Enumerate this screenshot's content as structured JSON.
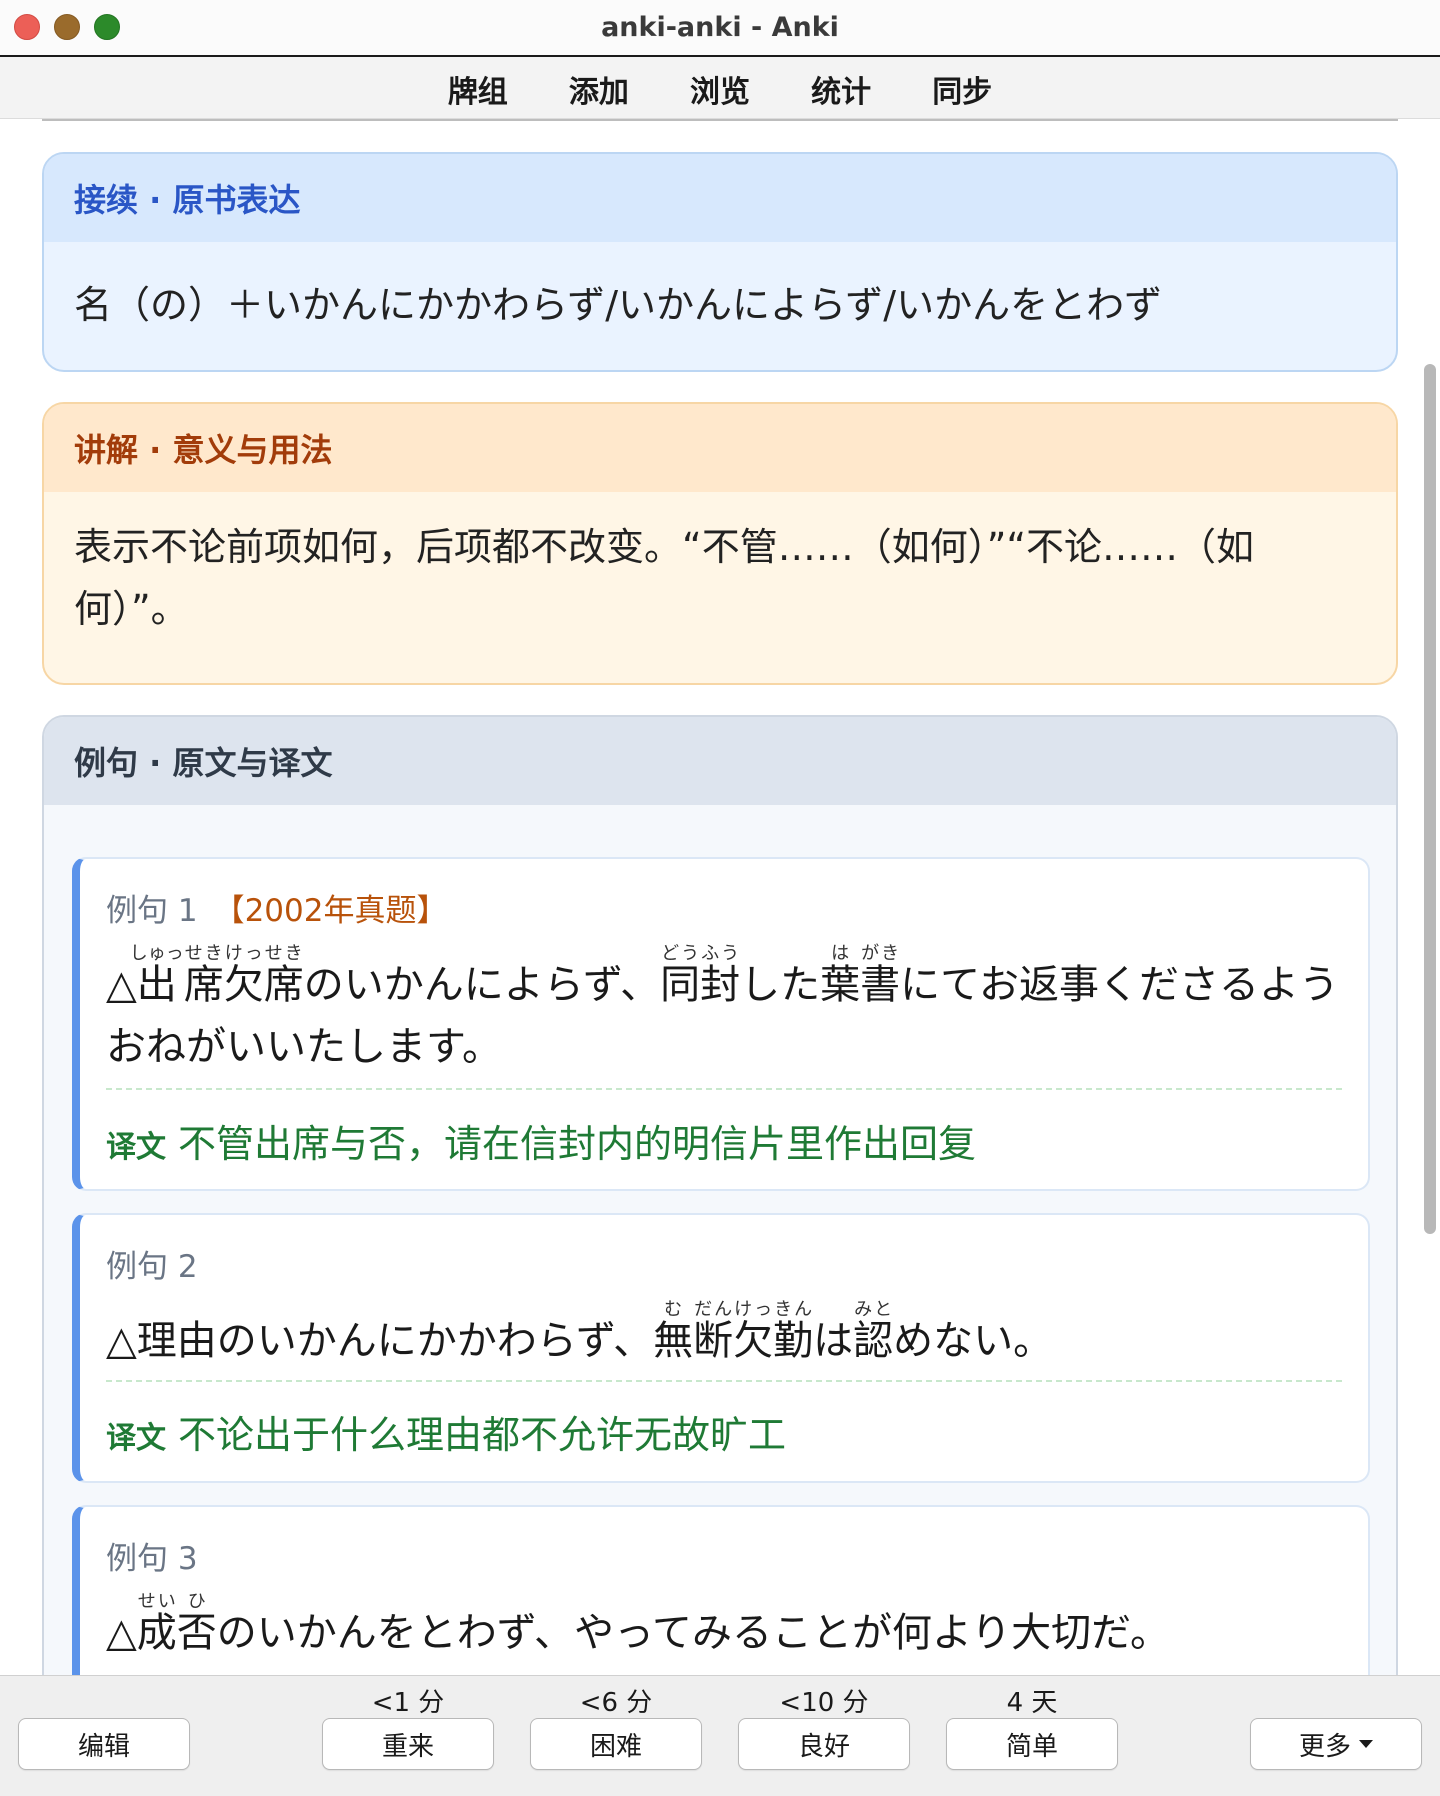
{
  "window": {
    "title": "anki-anki - Anki"
  },
  "menu": [
    "牌组",
    "添加",
    "浏览",
    "统计",
    "同步"
  ],
  "connection": {
    "header": "接续 · 原书表达",
    "text": "名（の）＋いかんにかかわらず/いかんによらず/いかんをとわず"
  },
  "explanation": {
    "header": "讲解 · 意义与用法",
    "text": "表示不论前项如何，后项都不改变。“不管……（如何）”“不论……（如何）”。"
  },
  "examples_section": {
    "header": "例句 · 原文与译文",
    "translation_label": "译文",
    "examples": [
      {
        "label": "例句 1",
        "tag": "【2002年真题】",
        "sentence": [
          {
            "t": "△"
          },
          {
            "t": "出",
            "r": "しゅっ"
          },
          {
            "t": "席",
            "r": "せき"
          },
          {
            "t": "欠",
            "r": "けっ"
          },
          {
            "t": "席",
            "r": "せき"
          },
          {
            "t": "のいかんによらず、"
          },
          {
            "t": "同",
            "r": "どう"
          },
          {
            "t": "封",
            "r": "ふう"
          },
          {
            "t": "した"
          },
          {
            "t": "葉",
            "r": "は"
          },
          {
            "t": "書",
            "r": "がき"
          },
          {
            "t": "にてお返事くださるようおねがいいたします。"
          }
        ],
        "translation": "不管出席与否，请在信封内的明信片里作出回复"
      },
      {
        "label": "例句 2",
        "tag": "",
        "sentence": [
          {
            "t": "△理由のいかんにかかわらず、"
          },
          {
            "t": "無",
            "r": "む"
          },
          {
            "t": "断",
            "r": "だん"
          },
          {
            "t": "欠",
            "r": "けっ"
          },
          {
            "t": "勤",
            "r": "きん"
          },
          {
            "t": "は"
          },
          {
            "t": "認",
            "r": "みと"
          },
          {
            "t": "めない。"
          }
        ],
        "translation": "不论出于什么理由都不允许无故旷工"
      },
      {
        "label": "例句 3",
        "tag": "",
        "sentence": [
          {
            "t": "△"
          },
          {
            "t": "成",
            "r": "せい"
          },
          {
            "t": "否",
            "r": "ひ"
          },
          {
            "t": "のいかんをとわず、やってみることが何より大切だ。"
          }
        ],
        "translation": ""
      }
    ]
  },
  "bottom": {
    "edit_label": "编辑",
    "more_label": "更多",
    "answers": [
      {
        "due": "<1 分",
        "label": "重来"
      },
      {
        "due": "<6 分",
        "label": "困难"
      },
      {
        "due": "<10 分",
        "label": "良好"
      },
      {
        "due": "4 天",
        "label": "简单"
      }
    ]
  },
  "icons": {
    "close": "traffic-close-icon",
    "minimize": "traffic-minimize-icon",
    "maximize": "traffic-maximize-icon",
    "more_caret": "caret-down-icon"
  },
  "colors": {
    "connection_accent": "#2a56c6",
    "explanation_accent": "#a23c0a",
    "translation_green": "#1f7a35",
    "example_border": "#5b93ea",
    "tag_orange": "#b8520a"
  }
}
